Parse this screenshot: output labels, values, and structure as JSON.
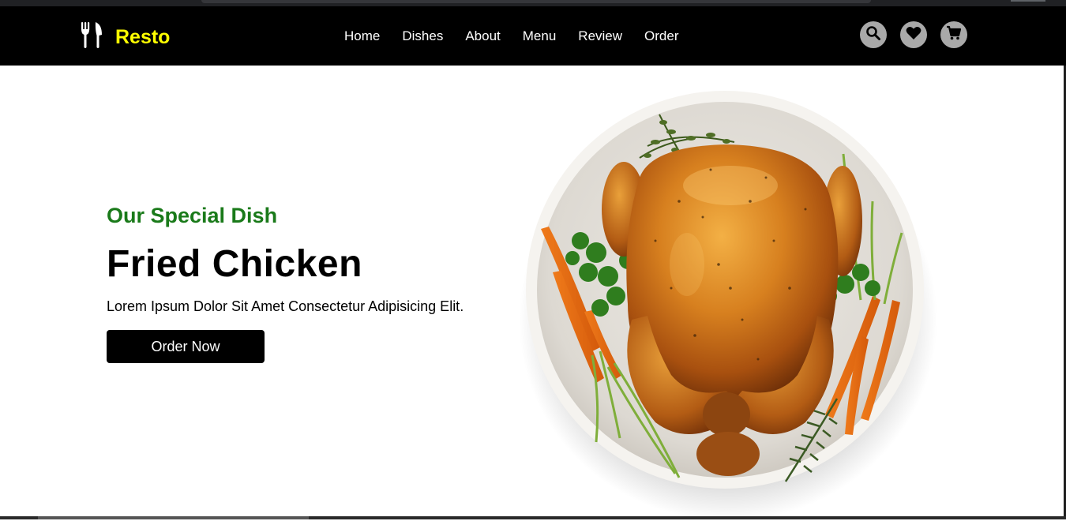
{
  "brand": {
    "name": "Resto",
    "logo_icon": "utensils-icon",
    "accent": "#ffff00"
  },
  "nav": {
    "items": [
      "Home",
      "Dishes",
      "About",
      "Menu",
      "Review",
      "Order"
    ]
  },
  "icons": [
    "search-icon",
    "heart-icon",
    "cart-icon"
  ],
  "hero": {
    "subtitle": "Our Special Dish",
    "title": "Fried Chicken",
    "description": "Lorem Ipsum Dolor Sit Amet Consectetur Adipisicing Elit.",
    "button_label": "Order Now",
    "subtitle_color": "#1a7a1a"
  }
}
